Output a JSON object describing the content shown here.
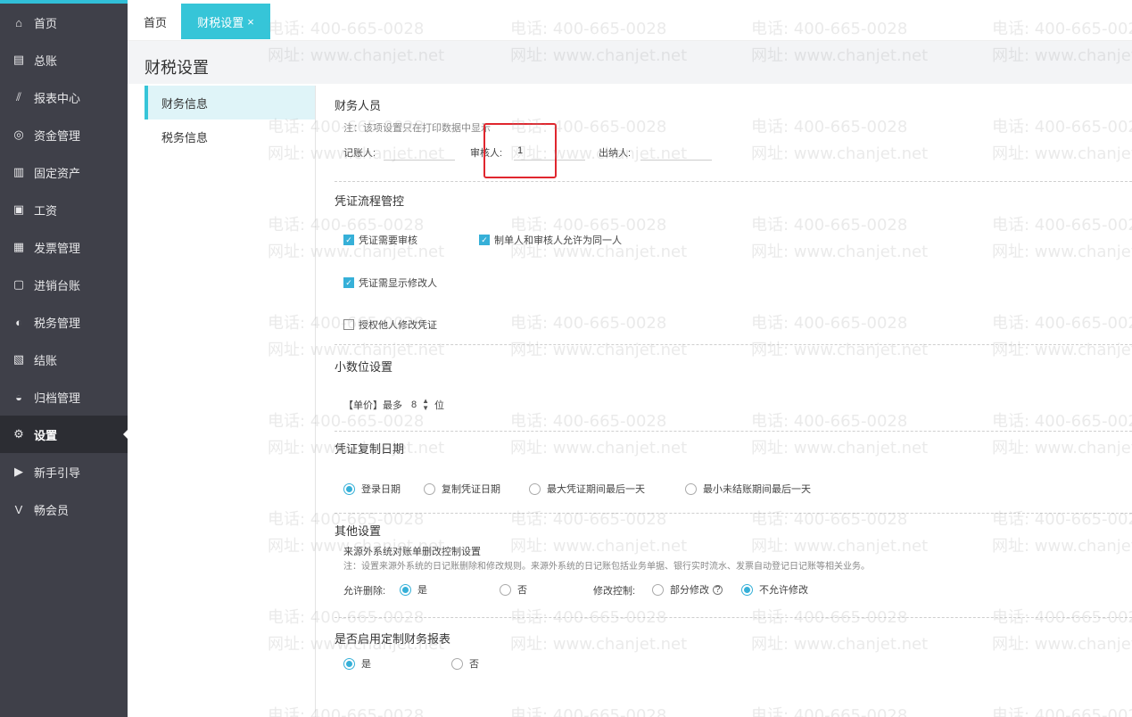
{
  "sidebar": {
    "items": [
      {
        "icon": "home-icon",
        "glyph": "⌂",
        "label": "首页"
      },
      {
        "icon": "ledger-icon",
        "glyph": "▤",
        "label": "总账"
      },
      {
        "icon": "chart-icon",
        "glyph": "⫽",
        "label": "报表中心"
      },
      {
        "icon": "money-icon",
        "glyph": "◎",
        "label": "资金管理"
      },
      {
        "icon": "asset-icon",
        "glyph": "▥",
        "label": "固定资产"
      },
      {
        "icon": "salary-icon",
        "glyph": "▣",
        "label": "工资"
      },
      {
        "icon": "invoice-icon",
        "glyph": "▦",
        "label": "发票管理"
      },
      {
        "icon": "inventory-icon",
        "glyph": "▢",
        "label": "进销台账"
      },
      {
        "icon": "tax-icon",
        "glyph": "◐",
        "label": "税务管理"
      },
      {
        "icon": "close-account-icon",
        "glyph": "▧",
        "label": "结账"
      },
      {
        "icon": "archive-icon",
        "glyph": "◒",
        "label": "归档管理"
      },
      {
        "icon": "gear-icon",
        "glyph": "⚙",
        "label": "设置"
      },
      {
        "icon": "guide-icon",
        "glyph": "▶",
        "label": "新手引导"
      },
      {
        "icon": "vip-icon",
        "glyph": "V",
        "label": "畅会员"
      }
    ],
    "active_index": 11
  },
  "tabs": {
    "home": "首页",
    "current": "财税设置",
    "close": "×"
  },
  "page": {
    "title": "财税设置"
  },
  "subnav": {
    "items": [
      "财务信息",
      "税务信息"
    ]
  },
  "finance_staff": {
    "title": "财务人员",
    "note": "注：该项设置只在打印数据中显示",
    "bookkeeper_label": "记账人:",
    "bookkeeper_value": "",
    "reviewer_label": "审核人:",
    "reviewer_value": "1",
    "cashier_label": "出纳人:",
    "cashier_value": ""
  },
  "voucher_flow": {
    "title": "凭证流程管控",
    "need_review": "凭证需要审核",
    "same_person": "制单人和审核人允许为同一人",
    "show_modifier": "凭证需显示修改人",
    "authorize_modify": "授权他人修改凭证"
  },
  "decimal": {
    "title": "小数位设置",
    "unit_price_label": "【单价】最多",
    "unit_price_value": "8",
    "unit_suffix": "位"
  },
  "copy_date": {
    "title": "凭证复制日期",
    "options": [
      "登录日期",
      "复制凭证日期",
      "最大凭证期间最后一天",
      "最小未结账期间最后一天"
    ],
    "selected": 0
  },
  "other": {
    "title": "其他设置",
    "subtitle": "来源外系统对账单删改控制设置",
    "note": "注：设置来源外系统的日记账删除和修改规则。来源外系统的日记账包括业务单据、银行实时流水、发票自动登记日记账等相关业务。",
    "allow_delete_label": "允许删除:",
    "yes": "是",
    "no": "否",
    "modify_label": "修改控制:",
    "partial": "部分修改",
    "disallow": "不允许修改"
  },
  "custom_report": {
    "title": "是否启用定制财务报表",
    "yes": "是",
    "no": "否"
  },
  "watermark": {
    "phone": "电话: 400-665-0028",
    "site": "网址: www.chanjet.net"
  },
  "colors": {
    "accent": "#36c5d8",
    "sidebar": "#3f4049",
    "highlight": "#e0262e"
  }
}
